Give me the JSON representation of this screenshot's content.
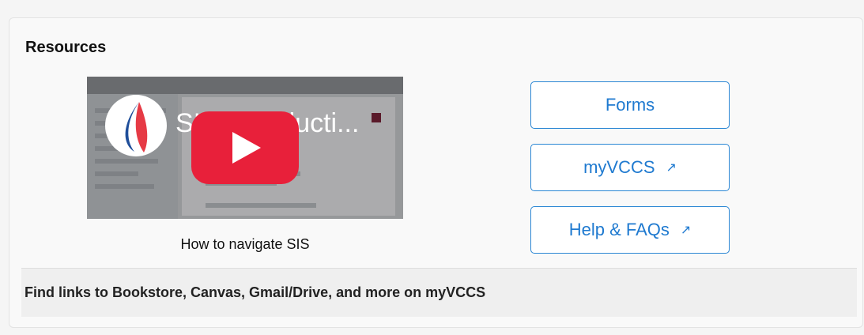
{
  "resources": {
    "title": "Resources",
    "video": {
      "thumbnail_title": "SIS Introducti...",
      "caption": "How to navigate SIS",
      "play_icon": "youtube-play-icon",
      "logo_icon": "vccs-logo-icon"
    },
    "links": [
      {
        "label": "Forms",
        "external": false
      },
      {
        "label": "myVCCS",
        "external": true,
        "icon": "external-link-icon",
        "glyph": "↗"
      },
      {
        "label": "Help & FAQs",
        "external": true,
        "icon": "external-link-icon",
        "glyph": "↗"
      }
    ],
    "footer_text": "Find links to Bookstore, Canvas, Gmail/Drive, and more on myVCCS"
  },
  "colors": {
    "accent": "#1f7ad0",
    "play_red": "#e8203a",
    "card_bg": "#f9f9f9"
  }
}
